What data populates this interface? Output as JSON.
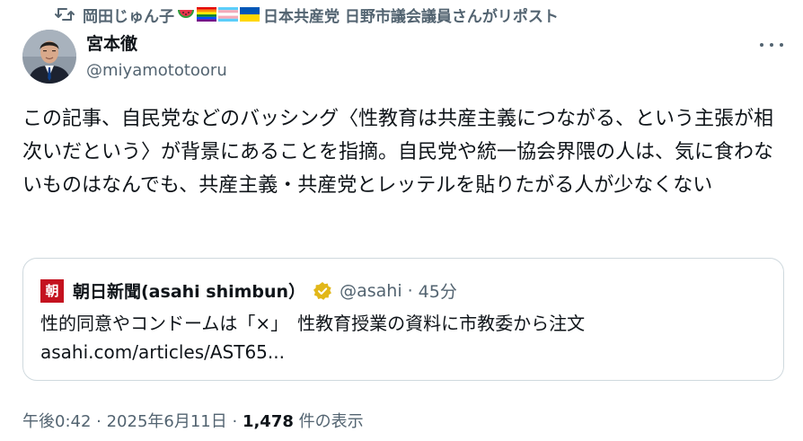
{
  "repost": {
    "icon": "repost-icon",
    "user_name": "岡田じゅん子",
    "emoji_icons": [
      "watermelon-icon",
      "rainbow-flag-icon",
      "transgender-flag-icon",
      "ukraine-flag-icon"
    ],
    "text": "日本共産党 日野市議会議員さんがリポスト"
  },
  "author": {
    "display_name": "宮本徹",
    "handle": "@miyamototooru",
    "avatar_icon": "avatar"
  },
  "more_icon": "more-horizontal-icon",
  "tweet": {
    "text": "この記事、自民党などのバッシング〈性教育は共産主義につながる、という主張が相次いだという〉が背景にあることを指摘。自民党や統一協会界隈の人は、気に食わないものはなんでも、共産主義・共産党とレッテルを貼りたがる人が少なくない"
  },
  "quote": {
    "logo_text": "朝",
    "name": "朝日新聞(asahi shimbun）",
    "verified_icon": "verified-badge-icon",
    "handle": "@asahi",
    "separator": "·",
    "time": "45分",
    "text": "性的同意やコンドームは「×」　性教育授業の資料に市教委から注文 asahi.com/articles/AST65..."
  },
  "meta": {
    "time": "午後0:42",
    "sep1": " · ",
    "date": "2025年6月11日",
    "sep2": " · ",
    "view_count": "1,478",
    "view_label": " 件の表示"
  }
}
